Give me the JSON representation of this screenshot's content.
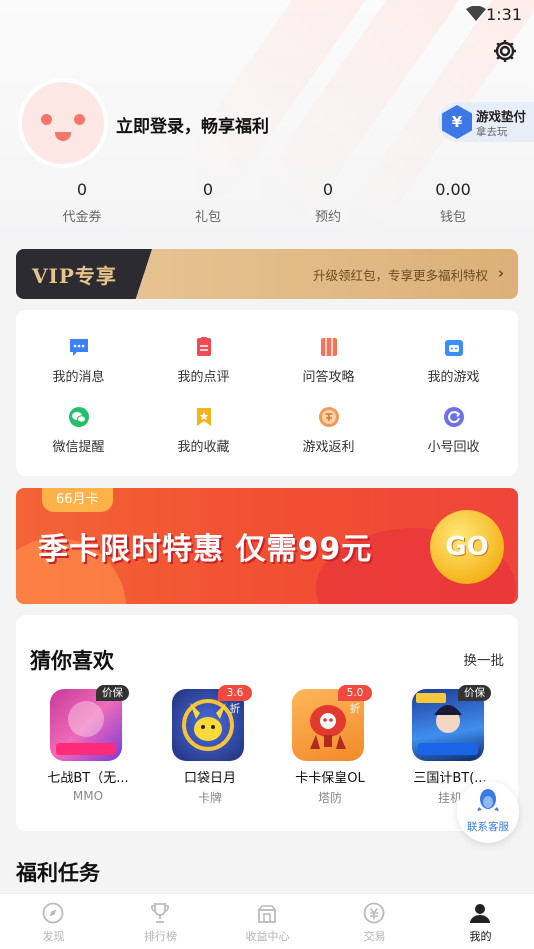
{
  "status_bar": {
    "time": "1:31"
  },
  "profile": {
    "login_prompt": "立即登录，畅享福利",
    "pay_badge_title": "游戏垫付",
    "pay_badge_sub": "拿去玩",
    "pay_badge_symbol": "¥"
  },
  "stats": [
    {
      "value": "0",
      "label": "代金券"
    },
    {
      "value": "0",
      "label": "礼包"
    },
    {
      "value": "0",
      "label": "预约"
    },
    {
      "value": "0.00",
      "label": "钱包"
    }
  ],
  "vip": {
    "title": "VIP专享",
    "text": "升级领红包，专享更多福利特权"
  },
  "grid": [
    {
      "label": "我的消息",
      "color": "#3b82f6",
      "icon": "message-icon"
    },
    {
      "label": "我的点评",
      "color": "#f04a55",
      "icon": "review-icon"
    },
    {
      "label": "问答攻略",
      "color": "#f0765a",
      "icon": "book-icon"
    },
    {
      "label": "我的游戏",
      "color": "#3b8ef2",
      "icon": "gamepad-icon"
    },
    {
      "label": "微信提醒",
      "color": "#22c06a",
      "icon": "wechat-icon"
    },
    {
      "label": "我的收藏",
      "color": "#f5b31c",
      "icon": "bookmark-icon"
    },
    {
      "label": "游戏返利",
      "color": "#f09a55",
      "icon": "rebate-icon"
    },
    {
      "label": "小号回收",
      "color": "#6a72e8",
      "icon": "recycle-icon"
    }
  ],
  "promo": {
    "tag": "66月卡",
    "text": "季卡限时特惠 仅需99元",
    "go": "GO"
  },
  "guess": {
    "title": "猜你喜欢",
    "swap": "换一批",
    "games": [
      {
        "name": "七战BT（无...",
        "genre": "MMO",
        "badge": "价保",
        "badge_color": "#333333"
      },
      {
        "name": "口袋日月",
        "genre": "卡牌",
        "badge": "3.6折",
        "badge_color": "#f0493f"
      },
      {
        "name": "卡卡保皇OL",
        "genre": "塔防",
        "badge": "5.0折",
        "badge_color": "#f0493f"
      },
      {
        "name": "三国计BT(...",
        "genre": "挂机",
        "badge": "价保",
        "badge_color": "#333333"
      }
    ]
  },
  "customer_service": "联系客服",
  "welfare_title": "福利任务",
  "nav": [
    {
      "label": "发现",
      "icon": "compass-icon"
    },
    {
      "label": "排行榜",
      "icon": "trophy-icon"
    },
    {
      "label": "收益中心",
      "icon": "store-icon"
    },
    {
      "label": "交易",
      "icon": "trade-icon"
    },
    {
      "label": "我的",
      "icon": "user-icon"
    }
  ]
}
